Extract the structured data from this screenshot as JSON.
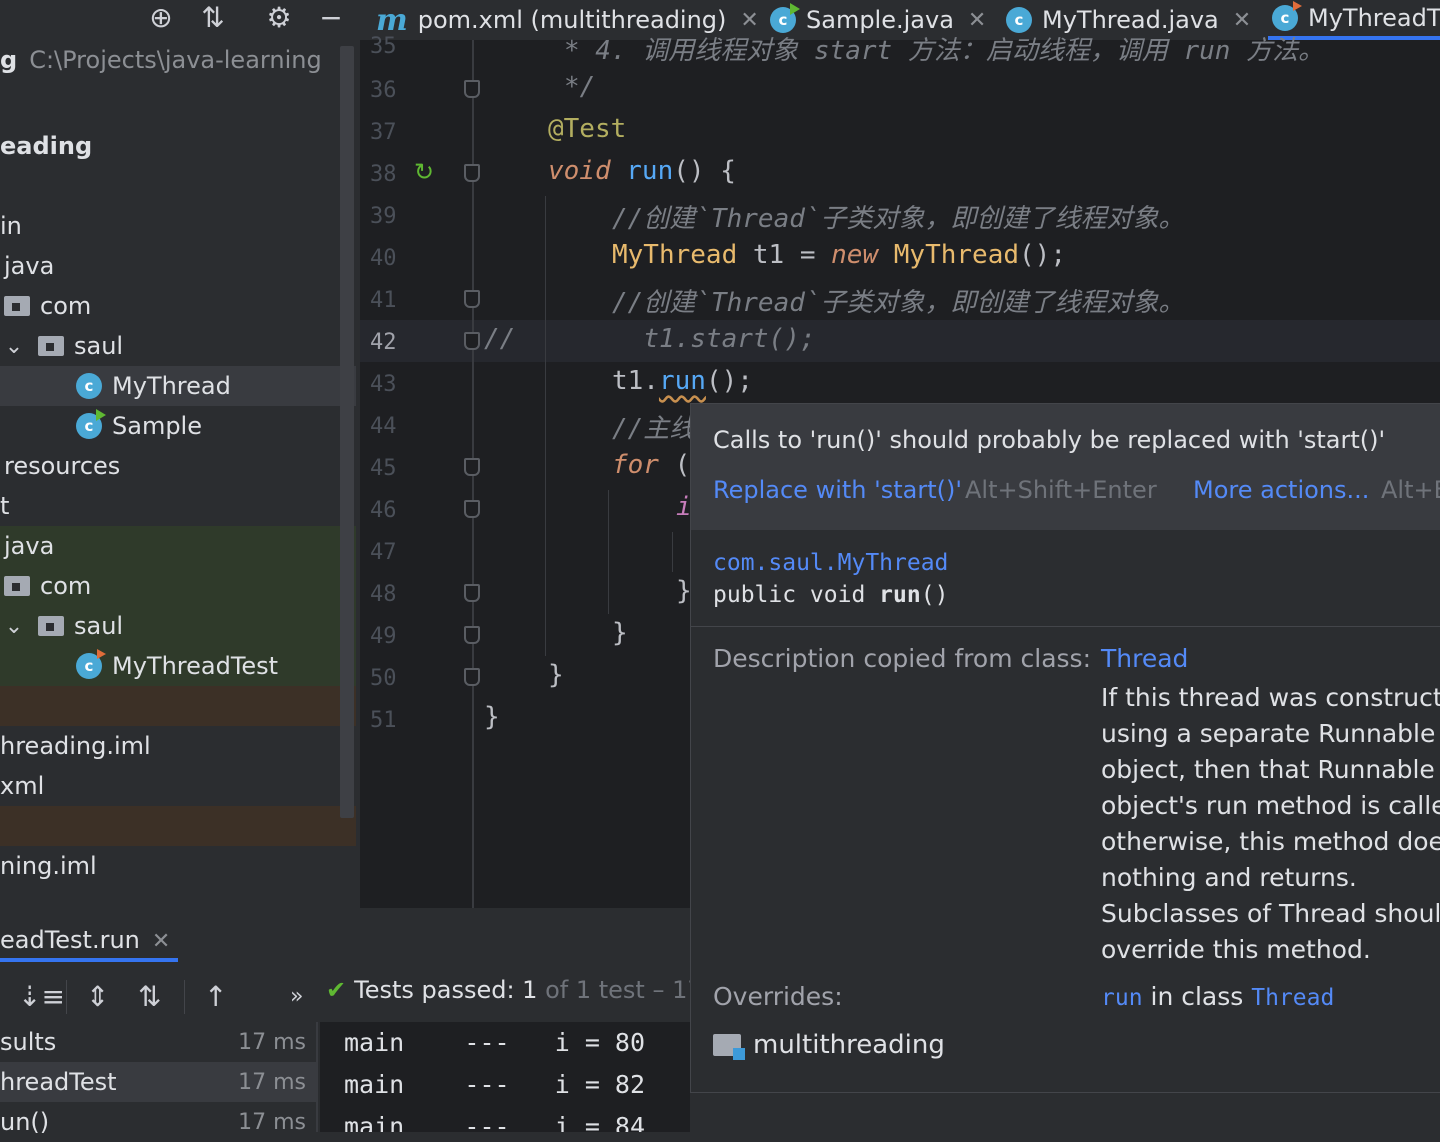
{
  "project_panel": {
    "path_prefix": "g",
    "path": "C:\\Projects\\java-learning",
    "tree": [
      {
        "label": "eading",
        "kind": "header"
      },
      {
        "label": "in",
        "kind": "plain"
      },
      {
        "label": "java",
        "kind": "plain"
      },
      {
        "label": "com",
        "kind": "folder"
      },
      {
        "label": "saul",
        "kind": "folder-open"
      },
      {
        "label": "MyThread",
        "kind": "class",
        "selected": true
      },
      {
        "label": "Sample",
        "kind": "class-run"
      },
      {
        "label": "resources",
        "kind": "plain"
      },
      {
        "label": "t",
        "kind": "plain"
      },
      {
        "label": "java",
        "kind": "test"
      },
      {
        "label": "com",
        "kind": "test-folder"
      },
      {
        "label": "saul",
        "kind": "test-folder-open"
      },
      {
        "label": "MyThreadTest",
        "kind": "test-class"
      },
      {
        "label": "",
        "kind": "excluded"
      },
      {
        "label": "hreading.iml",
        "kind": "plain"
      },
      {
        "label": "xml",
        "kind": "plain"
      },
      {
        "label": "",
        "kind": "excluded"
      },
      {
        "label": "ning.iml",
        "kind": "plain"
      }
    ]
  },
  "tabs": [
    {
      "label": "pom.xml (multithreading)",
      "icon": "maven-icon",
      "closable": true
    },
    {
      "label": "Sample.java",
      "icon": "java-class-run-icon",
      "closable": true
    },
    {
      "label": "MyThread.java",
      "icon": "java-class-icon",
      "closable": true
    },
    {
      "label": "MyThreadT",
      "icon": "java-test-class-icon",
      "closable": false,
      "active": true
    }
  ],
  "editor": {
    "line_numbers": [
      "35",
      "36",
      "37",
      "38",
      "39",
      "40",
      "41",
      "42",
      "43",
      "44",
      "45",
      "46",
      "47",
      "48",
      "49",
      "50",
      "51"
    ],
    "current_line": "42",
    "lines": {
      "l35": "* 4. 调用线程对象 start 方法：启动线程，调用 run 方法。",
      "l36": "*/",
      "l37": "@Test",
      "l38_kw": "void",
      "l38_fn": "run",
      "l38_rest": "() {",
      "l39": "//创建`Thread`子类对象，即创建了线程对象。",
      "l40_type": "MyThread",
      "l40_var": " t1 = ",
      "l40_new": "new",
      "l40_ctor": " MyThread",
      "l40_end": "();",
      "l41": "//创建`Thread`子类对象，即创建了线程对象。",
      "l42_prefix": "//",
      "l42_code": "t1.start();",
      "l43_obj": "t1.",
      "l43_call": "run",
      "l43_end": "();",
      "l44": "//主线",
      "l45_kw": "for",
      "l45_rest": " (",
      "l46": "i",
      "l48": "}",
      "l49": "}",
      "l50": "}",
      "l51": "}"
    }
  },
  "popup": {
    "message": "Calls to 'run()' should probably be replaced with 'start()'",
    "fix_label": "Replace with 'start()'",
    "fix_shortcut": "Alt+Shift+Enter",
    "more_label": "More actions...",
    "more_shortcut": "Alt+E",
    "doc_class": "com.saul.MyThread",
    "doc_sig_a": "public void ",
    "doc_sig_b": "run",
    "doc_sig_c": "()",
    "desc_label": "Description copied from class:",
    "desc_link": "Thread",
    "desc_lines": [
      "If this thread was construct",
      "using a separate Runnable r",
      "object, then that Runnable",
      "object's run method is calle",
      "otherwise, this method doe",
      "nothing and returns.",
      "Subclasses of Thread shoul",
      "override this method."
    ],
    "overrides_label": "Overrides:",
    "overrides_method": "run",
    "overrides_in": " in class ",
    "overrides_class": "Thread",
    "module": "multithreading"
  },
  "run_panel": {
    "tab_label": "eadTest.run",
    "status_prefix": "Tests passed: ",
    "status_count": "1",
    "status_rest": " of 1 test – 17",
    "results": [
      {
        "label": "sults",
        "time": "17 ms"
      },
      {
        "label": "hreadTest",
        "time": "17 ms"
      },
      {
        "label": "un()",
        "time": "17 ms"
      }
    ],
    "console": [
      "main    ---   i = 80",
      "main    ---   i = 82",
      "main    ---   i = 84"
    ]
  },
  "colors": {
    "accent": "#3574f0",
    "success": "#5fb832",
    "link": "#548af7"
  }
}
